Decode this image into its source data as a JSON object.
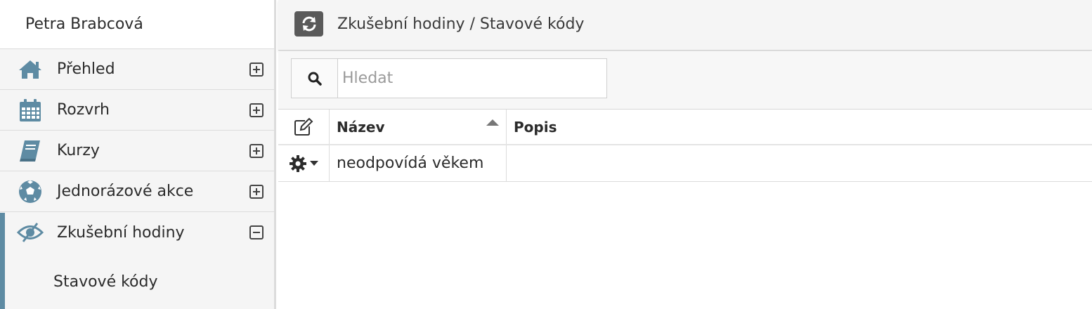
{
  "sidebar": {
    "user_name": "Petra Brabcová",
    "items": [
      {
        "label": "Přehled",
        "icon": "home-icon",
        "expanded": false
      },
      {
        "label": "Rozvrh",
        "icon": "calendar-icon",
        "expanded": false
      },
      {
        "label": "Kurzy",
        "icon": "book-icon",
        "expanded": false
      },
      {
        "label": "Jednorázové akce",
        "icon": "soccer-ball-icon",
        "expanded": false
      },
      {
        "label": "Zkušební hodiny",
        "icon": "eye-slash-icon",
        "expanded": true
      }
    ],
    "sub_items": [
      {
        "label": "Stavové kódy"
      }
    ],
    "accent_color": "#5e8ba3"
  },
  "header": {
    "breadcrumb": "Zkušební hodiny / Stavové kódy",
    "refresh_icon": "refresh-icon"
  },
  "search": {
    "placeholder": "Hledat",
    "value": ""
  },
  "table": {
    "columns": [
      "Název",
      "Popis"
    ],
    "sorted_column": "Název",
    "sort_direction": "asc",
    "rows": [
      {
        "name": "neodpovídá věkem",
        "description": ""
      }
    ]
  }
}
